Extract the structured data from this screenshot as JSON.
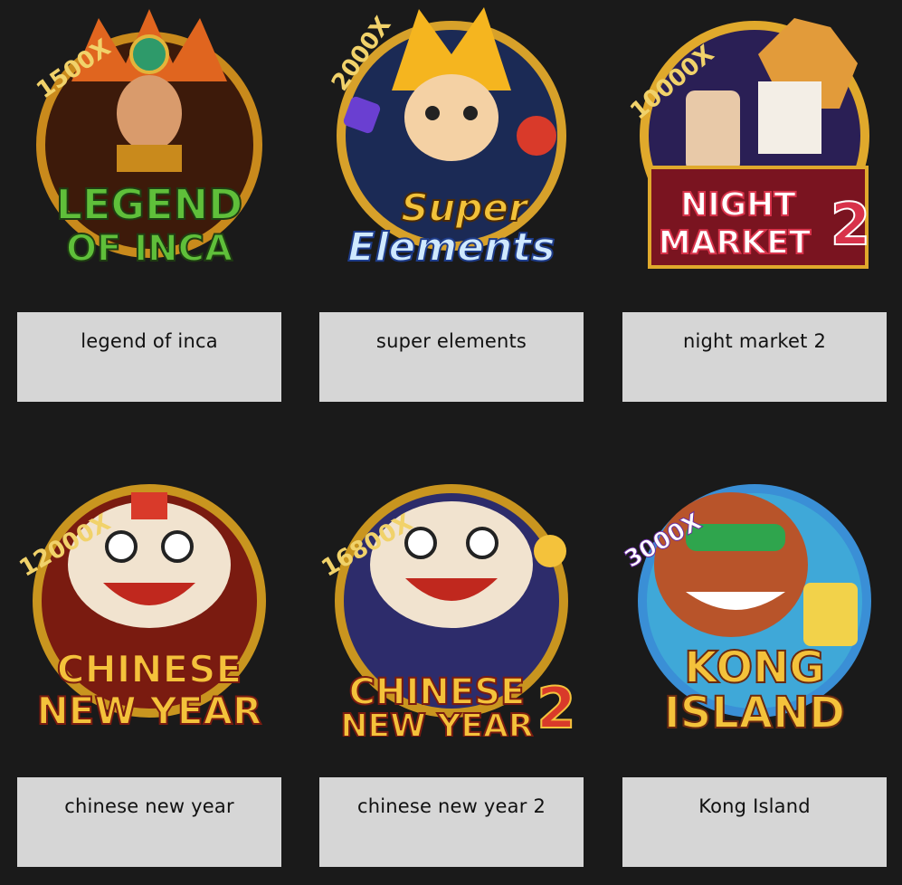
{
  "games": [
    {
      "title": "legend of inca",
      "multiplier": "1500X",
      "logo_line1": "LEGEND",
      "logo_line2": "OF INCA",
      "colors": {
        "ring": "#c98a1c",
        "bg": "#3d1a0a",
        "logo": "#5fbf3a"
      }
    },
    {
      "title": "super elements",
      "multiplier": "2000X",
      "logo_line1": "Super",
      "logo_line2": "Elements",
      "colors": {
        "ring": "#d7a12a",
        "bg": "#1b2a55",
        "logo": "#f2c23a"
      }
    },
    {
      "title": "night market 2",
      "multiplier": "10000X",
      "logo_line1": "NIGHT",
      "logo_line2": "MARKET",
      "logo_badge": "2",
      "colors": {
        "ring": "#e0a92c",
        "bg": "#2a1f55",
        "logo": "#d8324a"
      }
    },
    {
      "title": "chinese new year",
      "multiplier": "12000X",
      "logo_line1": "CHINESE",
      "logo_line2": "NEW YEAR",
      "colors": {
        "ring": "#c9951f",
        "bg": "#7a1b10",
        "logo": "#f4c23b"
      }
    },
    {
      "title": "chinese new year 2",
      "multiplier": "16800X",
      "logo_line1": "CHINESE",
      "logo_line2": "NEW YEAR",
      "logo_badge": "2",
      "colors": {
        "ring": "#c9951f",
        "bg": "#2d2c6b",
        "logo": "#f4c23b"
      }
    },
    {
      "title": "Kong Island",
      "multiplier": "3000X",
      "logo_line1": "KONG",
      "logo_line2": "ISLAND",
      "colors": {
        "ring": "#3a8fd6",
        "bg": "#3fa8d8",
        "logo": "#f4c23b"
      }
    }
  ]
}
